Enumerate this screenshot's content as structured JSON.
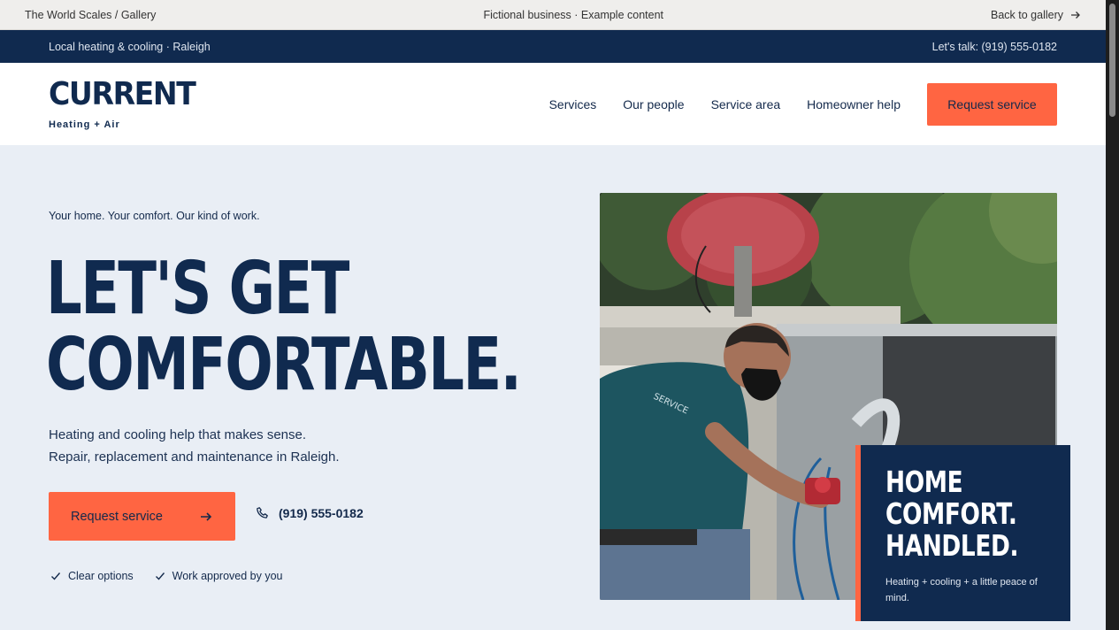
{
  "gallery_bar": {
    "left": "The World Scales / Gallery",
    "center": "Fictional business · Example content",
    "back_label": "Back to gallery",
    "back_icon": "arrow-right-icon"
  },
  "util_bar": {
    "location": "Local heating & cooling · Raleigh",
    "contact": "Let's talk: (919) 555-0182"
  },
  "header": {
    "logo_wordmark": "CURRENT",
    "logo_sub": "Heating + Air",
    "nav": [
      "Services",
      "Our people",
      "Service area",
      "Homeowner help"
    ],
    "cta_label": "Request service"
  },
  "hero": {
    "eyebrow": "Your home. Your comfort. Our kind of work.",
    "headline_line1": "LET'S GET",
    "headline_line2": "COMFORTABLE.",
    "lede_line1": "Heating and cooling help that makes sense.",
    "lede_line2": "Repair, replacement and maintenance in Raleigh.",
    "primary_button": "Request service",
    "primary_button_icon": "arrow-right-icon",
    "phone": "(919) 555-0182",
    "phone_icon": "phone-icon",
    "checks": [
      "Clear options",
      "Work approved by you"
    ],
    "check_icon": "check-icon"
  },
  "callout": {
    "title_line1": "HOME",
    "title_line2": "COMFORT.",
    "title_line3": "HANDLED.",
    "text": "Heating + cooling + a little peace of mind."
  },
  "colors": {
    "navy": "#102a4f",
    "accent": "#ff6542",
    "hero_bg": "#e9eef5"
  }
}
